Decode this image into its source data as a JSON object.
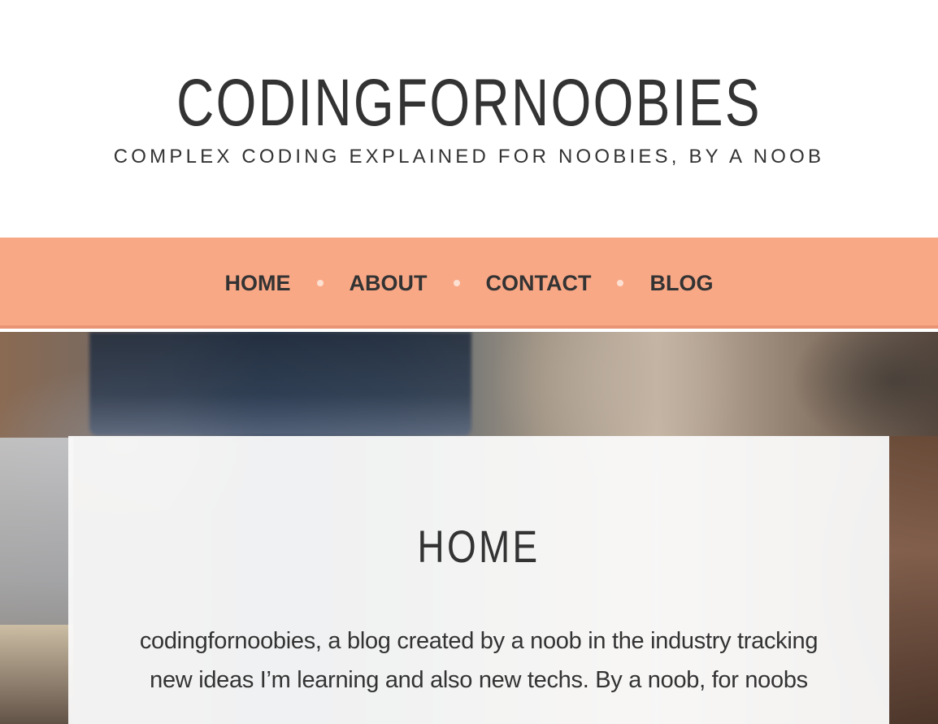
{
  "header": {
    "site_title": "CODINGFORNOOBIES",
    "tagline": "COMPLEX CODING EXPLAINED FOR NOOBIES, BY A NOOB"
  },
  "nav": {
    "items": [
      {
        "label": "HOME"
      },
      {
        "label": "ABOUT"
      },
      {
        "label": "CONTACT"
      },
      {
        "label": "BLOG"
      }
    ],
    "background_color": "#f9a886",
    "separator_color": "#fce0d2"
  },
  "hero": {
    "image": "blurred-desk-laptop-photo"
  },
  "content": {
    "page_title": "HOME",
    "body_text": "codingfornoobies, a blog created by a noob in the industry tracking new ideas I’m learning and also new techs. By a noob, for noobs"
  },
  "colors": {
    "text": "#333333",
    "page_background": "#ffffff",
    "card_background": "#fafafa"
  }
}
